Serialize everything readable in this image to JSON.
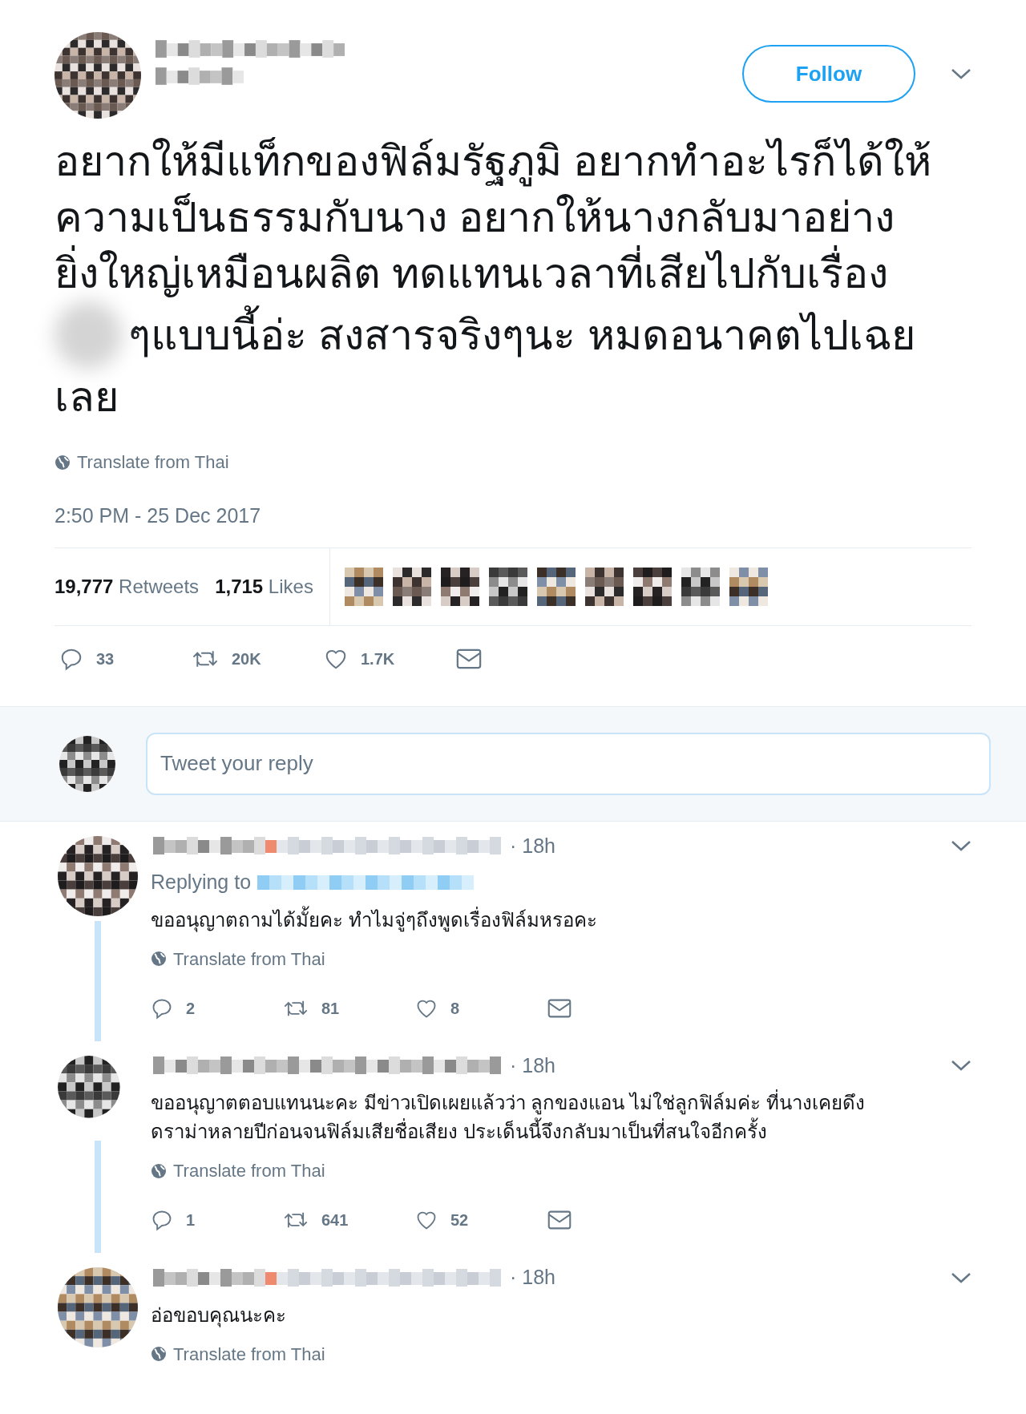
{
  "tweet": {
    "follow_button": "Follow",
    "text_before_blur": "อยากให้มีแท็กของฟิล์มรัฐภูมิ อยากทำอะไรก็ได้ให้\nความเป็นธรรมกับนาง อยากให้นางกลับมาอย่าง\nยิ่งใหญ่เหมือนผลิต ทดแทนเวลาที่เสียไปกับเรื่อง",
    "text_after_blur": "ๆแบบนี้อ่ะ สงสารจริงๆนะ หมดอนาคตไปเฉย",
    "text_last_line": "เลย",
    "translate": "Translate from Thai",
    "timestamp": "2:50 PM - 25 Dec 2017",
    "retweets": {
      "count": "19,777",
      "label": "Retweets"
    },
    "likes": {
      "count": "1,715",
      "label": "Likes"
    },
    "actions": {
      "replies": "33",
      "retweets": "20K",
      "likes": "1.7K"
    }
  },
  "reply_box": {
    "placeholder": "Tweet your reply"
  },
  "replies": [
    {
      "time": "· 18h",
      "replying_to": "Replying to",
      "text": "ขออนุญาตถามได้มั้ยคะ ทำไมจู่ๆถึงพูดเรื่องฟิล์มหรอคะ",
      "translate": "Translate from Thai",
      "actions": {
        "replies": "2",
        "retweets": "81",
        "likes": "8"
      }
    },
    {
      "time": "· 18h",
      "text": "ขออนุญาตตอบแทนนะคะ มีข่าวเปิดเผยแล้วว่า ลูกของแอน ไม่ใช่ลูกฟิล์มค่ะ ที่นางเคยดึง\nดราม่าหลายปีก่อนจนฟิล์มเสียชื่อเสียง ประเด็นนี้จึงกลับมาเป็นที่สนใจอีกครั้ง",
      "translate": "Translate from Thai",
      "actions": {
        "replies": "1",
        "retweets": "641",
        "likes": "52"
      }
    },
    {
      "time": "· 18h",
      "text": "อ่อขอบคุณนะคะ",
      "translate": "Translate from Thai"
    }
  ]
}
